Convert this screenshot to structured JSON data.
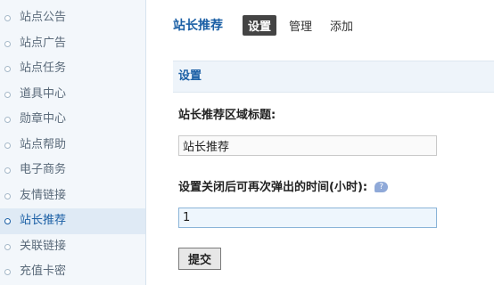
{
  "sidebar": {
    "items": [
      {
        "label": "站点公告",
        "active": false
      },
      {
        "label": "站点广告",
        "active": false
      },
      {
        "label": "站点任务",
        "active": false
      },
      {
        "label": "道具中心",
        "active": false
      },
      {
        "label": "勋章中心",
        "active": false
      },
      {
        "label": "站点帮助",
        "active": false
      },
      {
        "label": "电子商务",
        "active": false
      },
      {
        "label": "友情链接",
        "active": false
      },
      {
        "label": "站长推荐",
        "active": true
      },
      {
        "label": "关联链接",
        "active": false
      },
      {
        "label": "充值卡密",
        "active": false
      }
    ]
  },
  "header": {
    "title": "站长推荐",
    "tabs": [
      {
        "label": "设置",
        "active": true
      },
      {
        "label": "管理",
        "active": false
      },
      {
        "label": "添加",
        "active": false
      }
    ]
  },
  "panel": {
    "title": "设置",
    "fields": {
      "title_label": "站长推荐区域标题:",
      "title_value": "站长推荐",
      "hours_label": "设置关闭后可再次弹出的时间(小时):",
      "hours_value": "1"
    },
    "submit_label": "提交"
  },
  "colors": {
    "accent": "#1b5fa5",
    "sidebar_bg": "#f3f7fb",
    "sidebar_active_bg": "#dfeaf5",
    "tab_active_bg": "#444444",
    "panel_header_bg": "#eef4fa"
  },
  "icons": {
    "help": "speech-bubble-help-icon",
    "bullet": "circle-bullet-icon"
  }
}
